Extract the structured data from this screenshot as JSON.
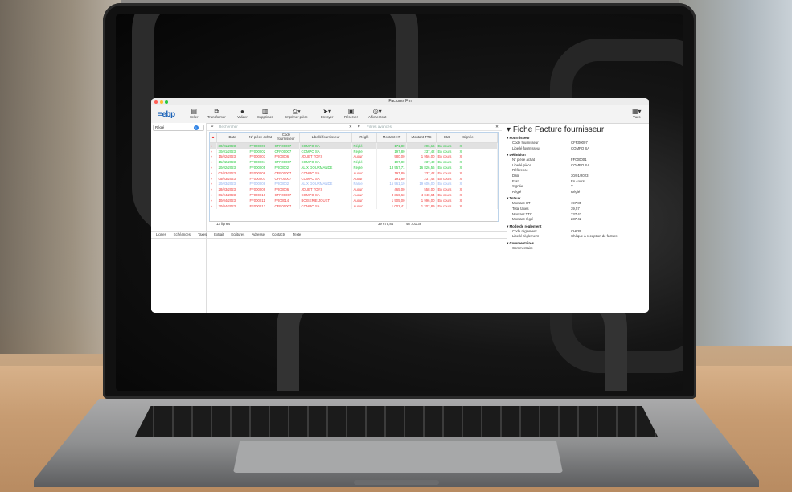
{
  "window": {
    "title": "Factures Frn"
  },
  "toolbar": {
    "logo": "≡ebp",
    "buttons": [
      {
        "label": "Créer",
        "icon": "document-plus-icon"
      },
      {
        "label": "Transformer",
        "icon": "transform-icon"
      },
      {
        "label": "Valider",
        "icon": "check-circle-icon"
      },
      {
        "label": "Supprimer",
        "icon": "trash-icon"
      },
      {
        "label": "Imprimer pièce",
        "icon": "printer-icon"
      },
      {
        "label": "Envoyer",
        "icon": "send-icon"
      },
      {
        "label": "Réserver",
        "icon": "lock-icon"
      },
      {
        "label": "Afficher tout",
        "icon": "eye-icon"
      },
      {
        "label": "Vues",
        "icon": "views-icon"
      }
    ]
  },
  "sidebar": {
    "filter_label": "Réglé",
    "info": "i"
  },
  "search": {
    "placeholder": "Rechercher",
    "filter_placeholder": "Filtres avancés"
  },
  "table": {
    "columns": [
      "Date",
      "N° pièce achat",
      "Code fournisseur",
      "Libellé fournisseur",
      "Réglé",
      "Montant HT",
      "Montant TTC",
      "Etat",
      "Signée"
    ],
    "rows": [
      {
        "cells": [
          "30/01/2023",
          "FF000001",
          "CFR00007",
          "COMPO SA",
          "Réglé",
          "171,80",
          "206,16",
          "En cours",
          "X"
        ],
        "color": "#27c93f",
        "selected": true
      },
      {
        "cells": [
          "30/01/2023",
          "FF000002",
          "CFR00007",
          "COMPO SA",
          "Réglé",
          "197,80",
          "237,42",
          "En cours",
          "X"
        ],
        "color": "#27c93f",
        "selected": false
      },
      {
        "cells": [
          "15/02/2023",
          "FF000003",
          "FR00006",
          "JOUET TOYS",
          "Aucun",
          "980,00",
          "1 956,00",
          "En cours",
          "X"
        ],
        "color": "#f03a3a",
        "selected": false
      },
      {
        "cells": [
          "15/02/2023",
          "FF000004",
          "CFR00007",
          "COMPO SA",
          "Réglé",
          "197,80",
          "237,42",
          "En cours",
          "X"
        ],
        "color": "#27c93f",
        "selected": false
      },
      {
        "cells": [
          "20/02/2023",
          "FF000005",
          "FR00002",
          "ALIX GOURMANDE",
          "Réglé",
          "13 957,71",
          "16 826,56",
          "En cours",
          "X"
        ],
        "color": "#27c93f",
        "selected": false
      },
      {
        "cells": [
          "02/03/2023",
          "FF000006",
          "CFR00007",
          "COMPO SA",
          "Aucun",
          "197,80",
          "237,42",
          "En cours",
          "X"
        ],
        "color": "#f03a3a",
        "selected": false
      },
      {
        "cells": [
          "05/03/2023",
          "FF000007",
          "CFR00007",
          "COMPO SA",
          "Aucun",
          "191,80",
          "237,42",
          "En cours",
          "X"
        ],
        "color": "#f03a3a",
        "selected": false
      },
      {
        "cells": [
          "20/03/2023",
          "FF000008",
          "FR00002",
          "ALIX GOURMANDE",
          "Partiel",
          "15 961,19",
          "19 606,00",
          "En cours",
          "X"
        ],
        "color": "#8fb0f0",
        "selected": false
      },
      {
        "cells": [
          "28/03/2023",
          "FF000009",
          "FR00006",
          "JOUET TOYS",
          "Aucun",
          "465,00",
          "558,00",
          "En cours",
          "X"
        ],
        "color": "#f03a3a",
        "selected": false
      },
      {
        "cells": [
          "06/04/2023",
          "FF000010",
          "CFR00007",
          "COMPO SA",
          "Aucun",
          "3 366,63",
          "4 040,64",
          "En cours",
          "X"
        ],
        "color": "#f03a3a",
        "selected": false
      },
      {
        "cells": [
          "10/04/2023",
          "FF000011",
          "FR00014",
          "BOISERIE JOUET",
          "Aucun",
          "1 905,00",
          "1 996,00",
          "En cours",
          "X"
        ],
        "color": "#f03a3a",
        "selected": false
      },
      {
        "cells": [
          "20/04/2023",
          "FF000012",
          "CFR00007",
          "COMPO SA",
          "Aucun",
          "1 002,41",
          "1 202,89",
          "En cours",
          "X"
        ],
        "color": "#f03a3a",
        "selected": false
      }
    ],
    "footer": {
      "count": "13 lignes",
      "sum_ht": "39 675,84",
      "sum_ttc": "48 101,39"
    }
  },
  "tabs": [
    "Lignes",
    "Echéances",
    "Taxes",
    "Extrait",
    "Ecritures",
    "Adresse",
    "Contacts",
    "Texte"
  ],
  "detail": {
    "title": "Fiche Facture fournisseur",
    "sections": [
      {
        "name": "Fournisseur",
        "rows": [
          [
            "Code fournisseur",
            "CFR00007"
          ],
          [
            "Libellé fournisseur",
            "COMPO SA"
          ]
        ]
      },
      {
        "name": "Définition",
        "rows": [
          [
            "N° pièce achat",
            "FF000001"
          ],
          [
            "Libellé pièce",
            "COMPO SA"
          ],
          [
            "Référence",
            ""
          ],
          [
            "Date",
            "30/01/2023"
          ],
          [
            "Etat",
            "En cours"
          ],
          [
            "Signée",
            "X"
          ],
          [
            "Réglé",
            "Réglé"
          ]
        ]
      },
      {
        "name": "Totaux",
        "rows": [
          [
            "Montant HT",
            "197,85"
          ],
          [
            "Total taxes",
            "39,57"
          ],
          [
            "Montant TTC",
            "237,42"
          ],
          [
            "Montant réglé",
            "237,42"
          ]
        ]
      },
      {
        "name": "Mode de règlement",
        "rows": [
          [
            "Code règlement",
            "CHKR"
          ],
          [
            "Libellé règlement",
            "Chèque à réception de facture"
          ]
        ]
      },
      {
        "name": "Commentaires",
        "rows": [
          [
            "Commentaire",
            ""
          ]
        ]
      }
    ]
  }
}
